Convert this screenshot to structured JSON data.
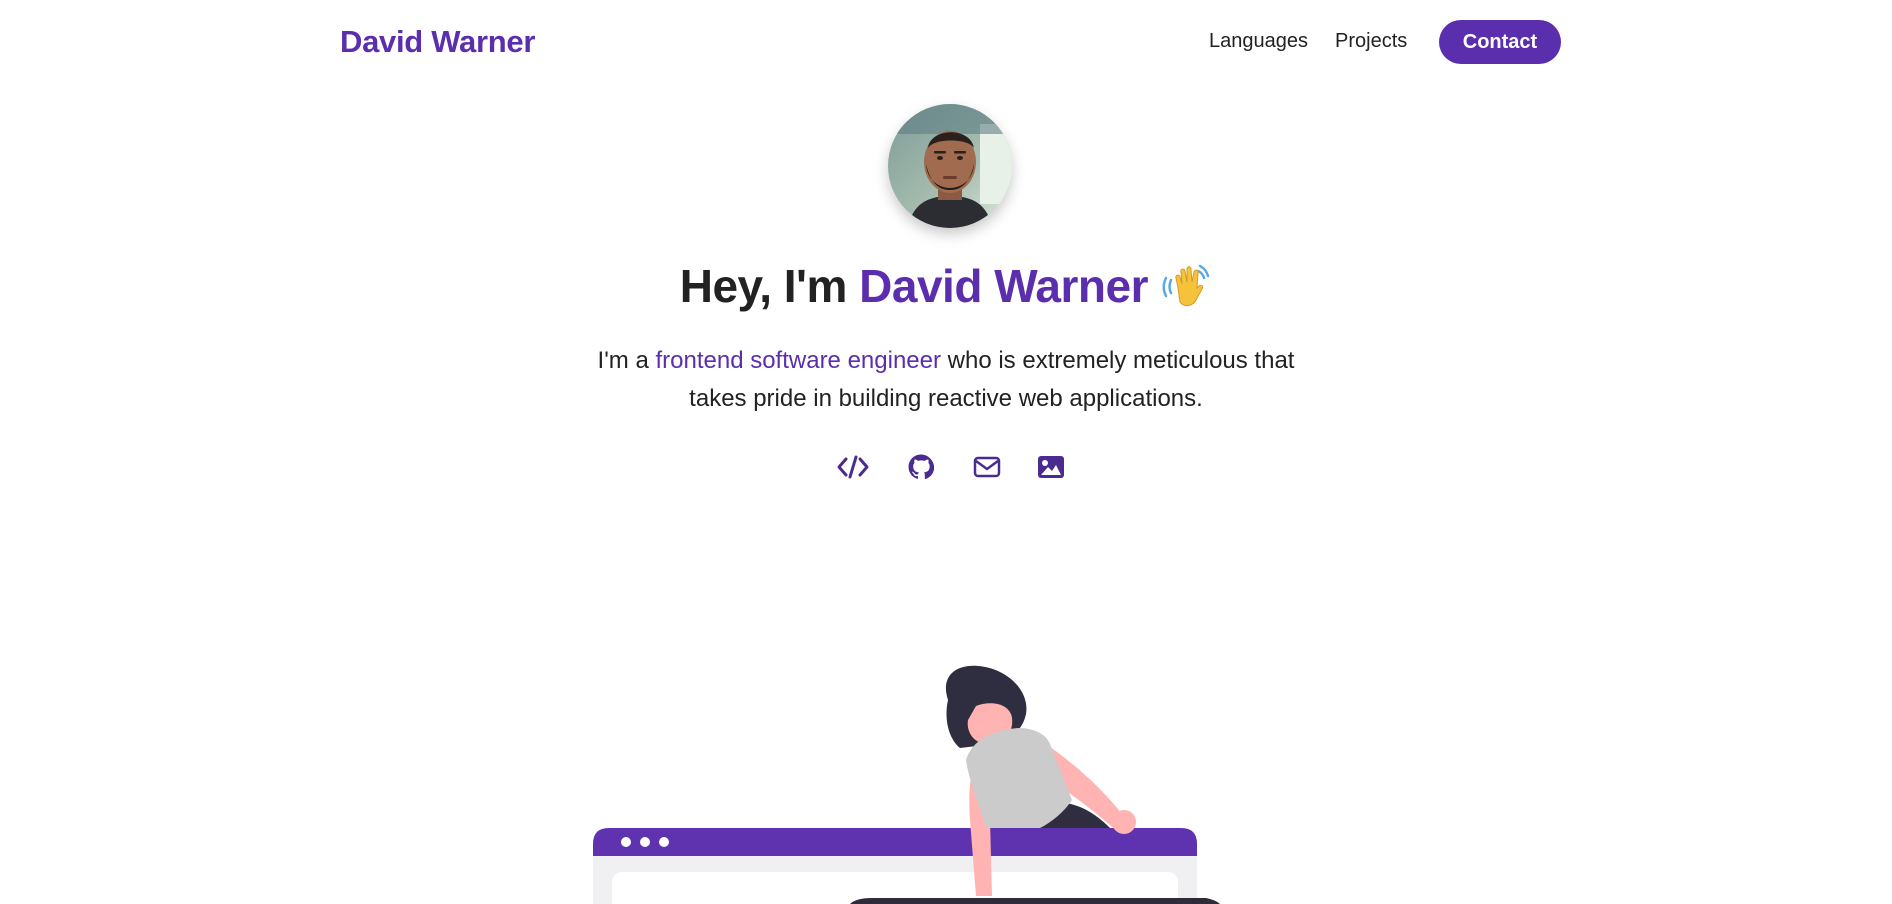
{
  "header": {
    "brand": "David Warner",
    "nav": [
      {
        "label": "Languages"
      },
      {
        "label": "Projects"
      }
    ],
    "contact_label": "Contact"
  },
  "hero": {
    "title_prefix": "Hey, I'm ",
    "title_name": "David Warner",
    "wave_emoji": "waving-hand-icon",
    "subtitle_prefix": "I'm a ",
    "subtitle_highlight": "frontend software engineer",
    "subtitle_suffix": " who is extremely meticulous that takes pride in building reactive web applications.",
    "social_icons": [
      "code-icon",
      "github-icon",
      "mail-icon",
      "image-icon"
    ]
  },
  "colors": {
    "accent": "#5b2eae",
    "text": "#222222",
    "background": "#ffffff"
  }
}
